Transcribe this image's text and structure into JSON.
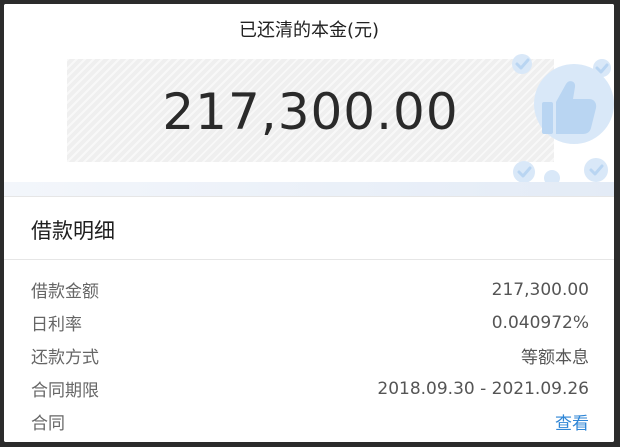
{
  "summary": {
    "title": "已还清的本金(元)",
    "amount": "217,300.00"
  },
  "details": {
    "title": "借款明细",
    "rows": [
      {
        "label": "借款金额",
        "value": "217,300.00"
      },
      {
        "label": "日利率",
        "value": "0.040972%"
      },
      {
        "label": "还款方式",
        "value": "等额本息"
      },
      {
        "label": "合同期限",
        "value": "2018.09.30 - 2021.09.26"
      },
      {
        "label": "合同",
        "value": "查看"
      }
    ]
  },
  "colors": {
    "link": "#2f86d6",
    "decoration": "#b9d5f2"
  }
}
